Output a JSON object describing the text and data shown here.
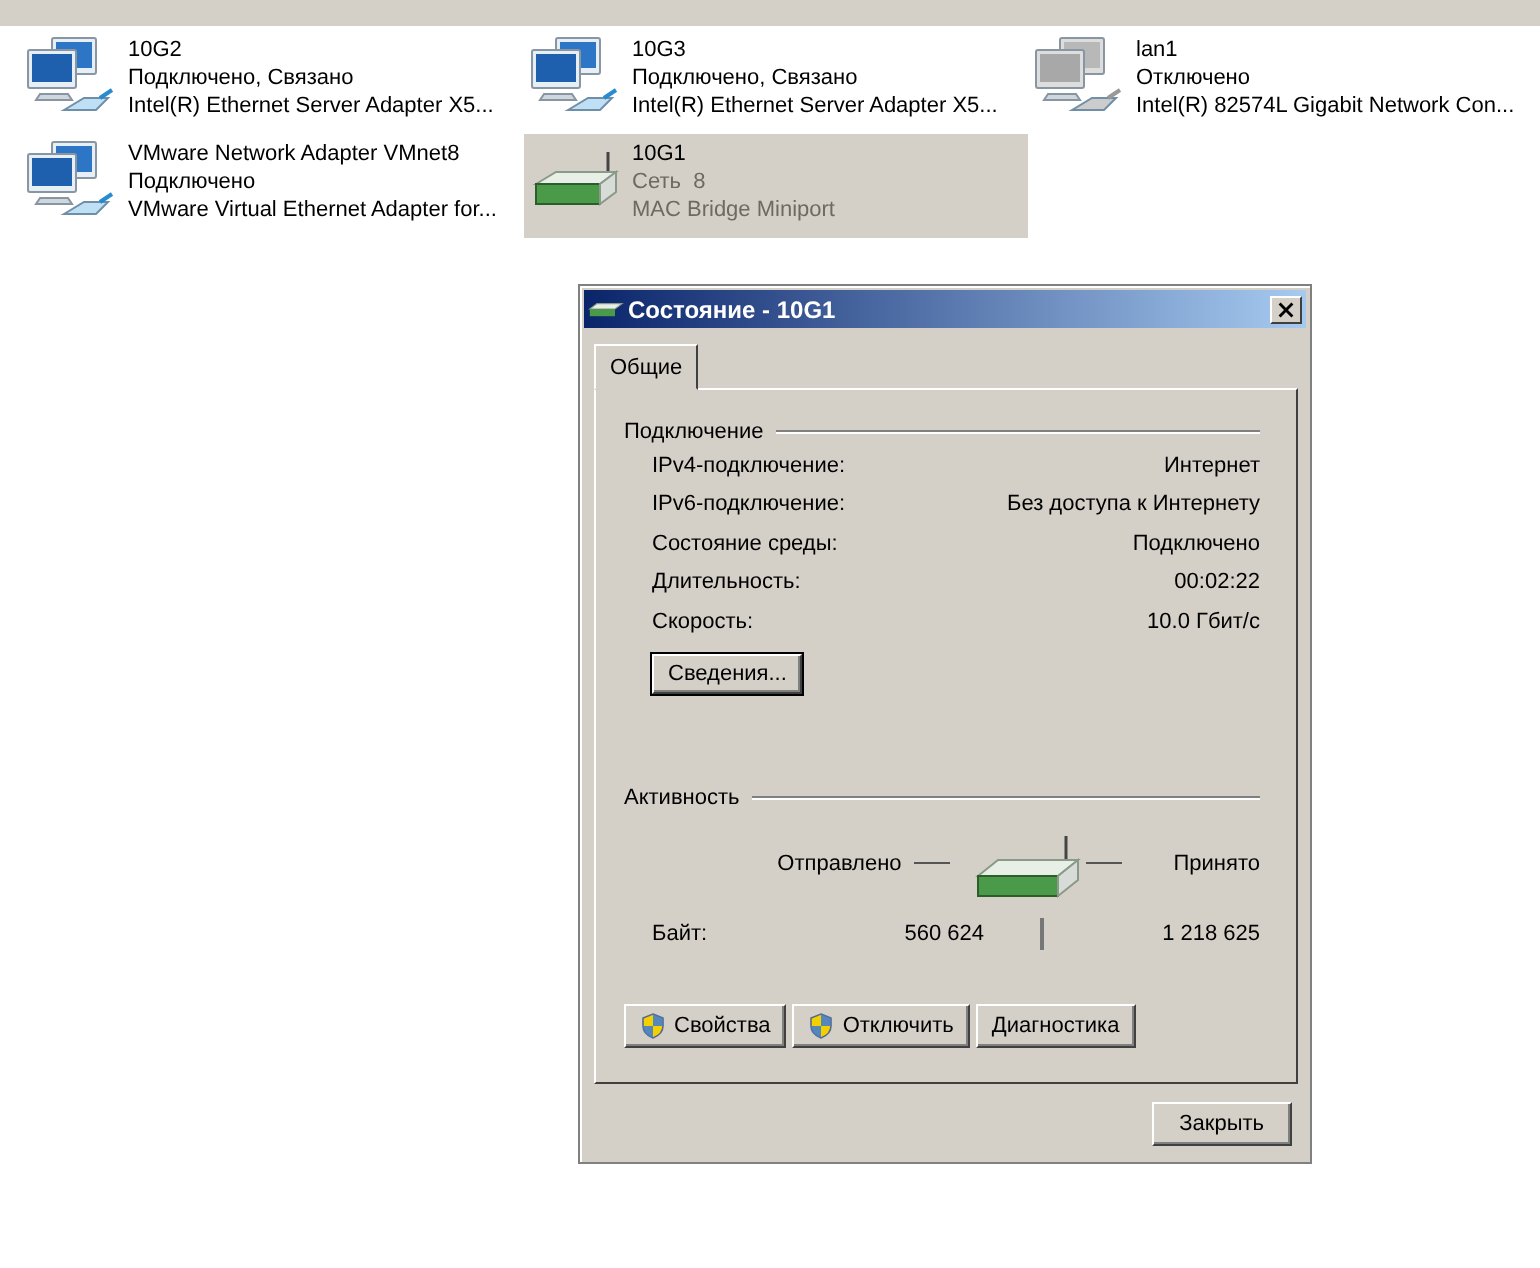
{
  "adapters": [
    {
      "name": "10G2",
      "status": "Подключено, Связано",
      "device": "Intel(R) Ethernet Server Adapter X5...",
      "kind": "computer",
      "disabled": false,
      "selected": false
    },
    {
      "name": "10G3",
      "status": "Подключено, Связано",
      "device": "Intel(R) Ethernet Server Adapter X5...",
      "kind": "computer",
      "disabled": false,
      "selected": false
    },
    {
      "name": "lan1",
      "status": "Отключено",
      "device": "Intel(R) 82574L Gigabit Network Con...",
      "kind": "computer",
      "disabled": true,
      "selected": false
    },
    {
      "name": "VMware Network Adapter VMnet8",
      "status": "Подключено",
      "device": "VMware Virtual Ethernet Adapter for...",
      "kind": "computer",
      "disabled": false,
      "selected": false
    },
    {
      "name": "10G1",
      "status": "Сеть  8",
      "device": "MAC Bridge Miniport",
      "kind": "bridge",
      "disabled": false,
      "selected": true
    }
  ],
  "dialog": {
    "title": "Состояние - 10G1",
    "tabs": [
      {
        "label": "Общие",
        "selected": true
      }
    ],
    "connection": {
      "title": "Подключение",
      "rows": [
        {
          "label": "IPv4-подключение:",
          "value": "Интернет"
        },
        {
          "label": "IPv6-подключение:",
          "value": "Без доступа к Интернету"
        },
        {
          "label": "Состояние среды:",
          "value": "Подключено"
        },
        {
          "label": "Длительность:",
          "value": "00:02:22"
        },
        {
          "label": "Скорость:",
          "value": "10.0 Гбит/с"
        }
      ],
      "details_button": "Сведения..."
    },
    "activity": {
      "title": "Активность",
      "sent_label": "Отправлено",
      "received_label": "Принято",
      "bytes_label": "Байт:",
      "bytes_sent": "560 624",
      "bytes_received": "1 218 625"
    },
    "buttons": [
      {
        "label": "Свойства",
        "kind": "shield"
      },
      {
        "label": "Отключить",
        "kind": "shield"
      },
      {
        "label": "Диагностика",
        "kind": "plain"
      }
    ],
    "close_button": "Закрыть"
  }
}
